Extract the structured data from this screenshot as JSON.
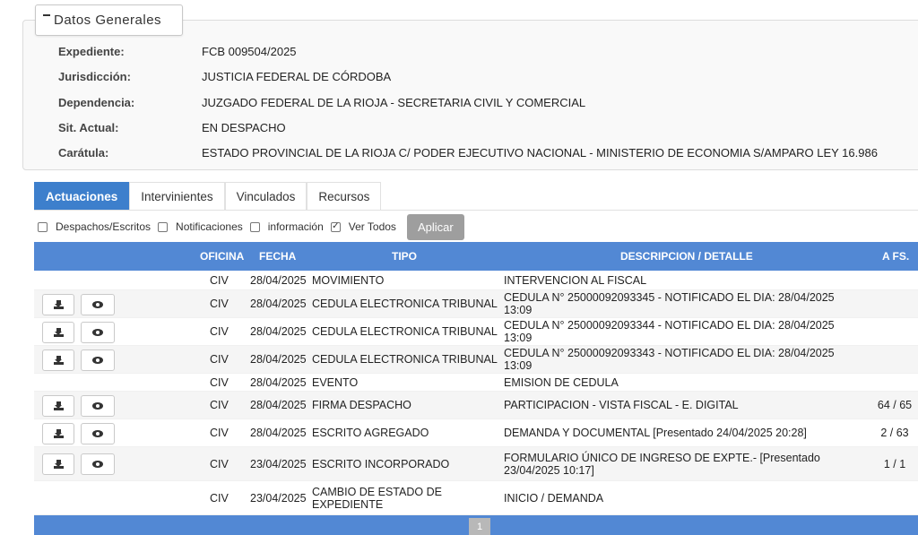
{
  "datos_generales": {
    "title": "Datos Generales",
    "fields": [
      {
        "label": "Expediente:",
        "value": "FCB 009504/2025"
      },
      {
        "label": "Jurisdicción:",
        "value": "JUSTICIA FEDERAL DE CÓRDOBA"
      },
      {
        "label": "Dependencia:",
        "value": "JUZGADO FEDERAL DE LA RIOJA - SECRETARIA CIVIL Y COMERCIAL"
      },
      {
        "label": "Sit. Actual:",
        "value": "EN DESPACHO"
      },
      {
        "label": "Carátula:",
        "value": "ESTADO PROVINCIAL DE LA RIOJA C/ PODER EJECUTIVO NACIONAL - MINISTERIO DE ECONOMIA S/AMPARO LEY 16.986"
      }
    ]
  },
  "tabs": [
    "Actuaciones",
    "Intervinientes",
    "Vinculados",
    "Recursos"
  ],
  "active_tab": "Actuaciones",
  "filters": [
    {
      "label": "Despachos/Escritos",
      "checked": false
    },
    {
      "label": "Notificaciones",
      "checked": false
    },
    {
      "label": "información",
      "checked": false
    },
    {
      "label": "Ver Todos",
      "checked": true
    }
  ],
  "apply_label": "Aplicar",
  "table": {
    "headers": {
      "oficina": "OFICINA",
      "fecha": "FECHA",
      "tipo": "TIPO",
      "descripcion": "DESCRIPCION / DETALLE",
      "afs": "A FS."
    },
    "rows": [
      {
        "actions": false,
        "oficina": "CIV",
        "fecha": "28/04/2025",
        "tipo": "MOVIMIENTO",
        "descripcion": "INTERVENCION AL FISCAL",
        "afs": ""
      },
      {
        "actions": true,
        "oficina": "CIV",
        "fecha": "28/04/2025",
        "tipo": "CEDULA ELECTRONICA TRIBUNAL",
        "descripcion": "CEDULA N° 25000092093345 - NOTIFICADO EL DIA: 28/04/2025 13:09",
        "afs": ""
      },
      {
        "actions": true,
        "oficina": "CIV",
        "fecha": "28/04/2025",
        "tipo": "CEDULA ELECTRONICA TRIBUNAL",
        "descripcion": "CEDULA N° 25000092093344 - NOTIFICADO EL DIA: 28/04/2025 13:09",
        "afs": ""
      },
      {
        "actions": true,
        "oficina": "CIV",
        "fecha": "28/04/2025",
        "tipo": "CEDULA ELECTRONICA TRIBUNAL",
        "descripcion": "CEDULA N° 25000092093343 - NOTIFICADO EL DIA: 28/04/2025 13:09",
        "afs": ""
      },
      {
        "actions": false,
        "oficina": "CIV",
        "fecha": "28/04/2025",
        "tipo": "EVENTO",
        "descripcion": "EMISION DE CEDULA",
        "afs": ""
      },
      {
        "actions": true,
        "oficina": "CIV",
        "fecha": "28/04/2025",
        "tipo": "FIRMA DESPACHO",
        "descripcion": "PARTICIPACION - VISTA FISCAL - E. DIGITAL",
        "afs": "64 / 65"
      },
      {
        "actions": true,
        "oficina": "CIV",
        "fecha": "28/04/2025",
        "tipo": "ESCRITO AGREGADO",
        "descripcion": "DEMANDA Y DOCUMENTAL [Presentado 24/04/2025 20:28]",
        "afs": "2 / 63"
      },
      {
        "actions": true,
        "oficina": "CIV",
        "fecha": "23/04/2025",
        "tipo": "ESCRITO INCORPORADO",
        "descripcion": "FORMULARIO ÚNICO DE INGRESO DE EXPTE.- [Presentado 23/04/2025 10:17]",
        "afs": "1 / 1"
      },
      {
        "actions": false,
        "oficina": "CIV",
        "fecha": "23/04/2025",
        "tipo": "CAMBIO DE ESTADO DE EXPEDIENTE",
        "descripcion": "INICIO / DEMANDA",
        "afs": ""
      }
    ]
  },
  "pagination": {
    "current": "1"
  },
  "icons": {
    "download": "download-icon",
    "view": "eye-icon",
    "collapse": "minus-icon"
  },
  "colors": {
    "header_blue": "#5288d4",
    "tab_active": "#3d7fcc",
    "apply_gray": "#9e9e9e"
  }
}
